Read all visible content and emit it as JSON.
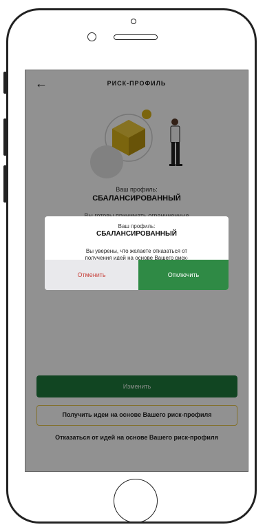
{
  "header": {
    "back_icon": "arrow-left-icon",
    "title": "РИСК-ПРОФИЛЬ"
  },
  "profile": {
    "caption": "Ваш профиль:",
    "value": "СБАЛАНСИРОВАННЫЙ",
    "description_peek": "Вы готовы принимать ограниченные"
  },
  "actions": {
    "change_label": "Изменить",
    "ideas_label": "Получить идеи на основе Вашего риск-профиля",
    "refuse_label": "Отказаться от идей на основе Вашего риск-профиля"
  },
  "modal": {
    "caption": "Ваш профиль:",
    "value": "СБАЛАНСИРОВАННЫЙ",
    "question": "Вы уверены, что желаете отказаться от получения идей на основе Вашего риск-профиля?",
    "cancel_label": "Отменить",
    "confirm_label": "Отключить"
  },
  "colors": {
    "accent_green": "#2f8a45",
    "dark_green": "#1f7a3d",
    "cancel_red": "#c8453f",
    "gold": "#d9b21a",
    "ideas_border": "#e5c64a"
  }
}
